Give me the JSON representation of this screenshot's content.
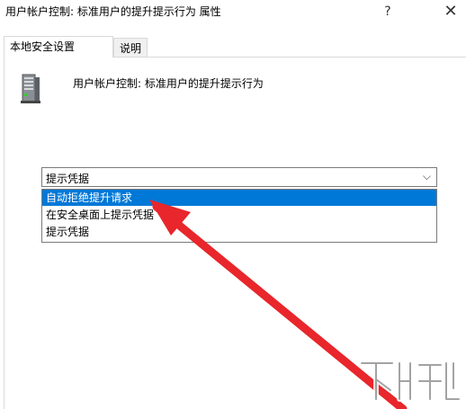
{
  "window": {
    "title": "用户帐户控制: 标准用户的提升提示行为 属性",
    "help_icon": "question-mark-icon",
    "close_icon": "close-icon"
  },
  "tabs": [
    {
      "label": "本地安全设置",
      "active": true
    },
    {
      "label": "说明",
      "active": false
    }
  ],
  "policy": {
    "icon": "server-policy-icon",
    "name": "用户帐户控制: 标准用户的提升提示行为"
  },
  "combo": {
    "selected_value": "提示凭据",
    "arrow_icon": "chevron-down-icon"
  },
  "dropdown": {
    "options": [
      "自动拒绝提升请求",
      "在安全桌面上提示凭据",
      "提示凭据"
    ],
    "highlighted_index": 0
  },
  "annotation": {
    "arrow_color": "#e8262b"
  },
  "watermark": {
    "icon": "xiazaiba-logo"
  },
  "colors": {
    "highlight": "#0078d7",
    "border": "#7a7a7a"
  }
}
